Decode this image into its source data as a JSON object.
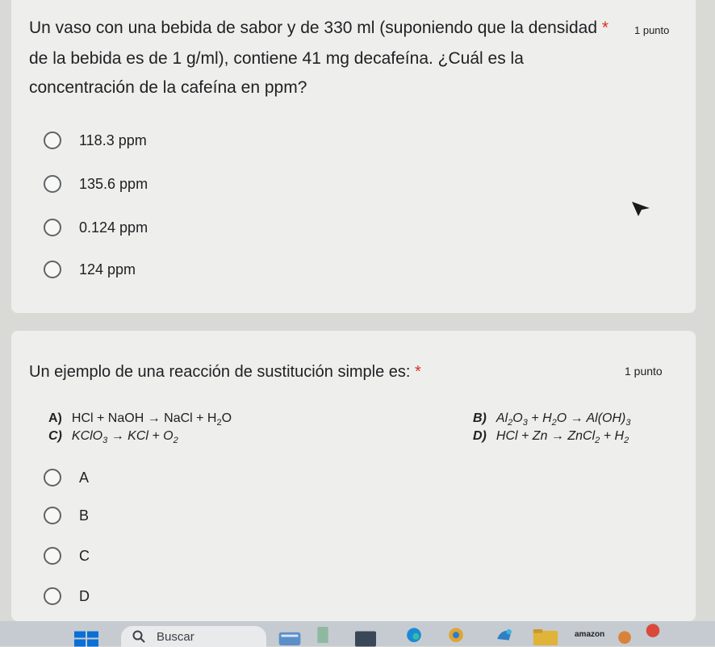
{
  "q1": {
    "line1": "Un vaso con una bebida de sabor y de 330 ml (suponiendo que la densidad",
    "required": "*",
    "points": "1 punto",
    "line2": "de la bebida es de 1 g/ml), contiene 41 mg decafeína. ¿Cuál es la",
    "line3": "concentración de la cafeína en ppm?",
    "options": [
      "118.3 ppm",
      "135.6 ppm",
      "0.124 ppm",
      "124 ppm"
    ]
  },
  "q2": {
    "title": "Un ejemplo de una reacción de sustitución simple es:",
    "required": "*",
    "points": "1 punto",
    "reactions": {
      "a_letter": "A)",
      "b_letter": "B)",
      "c_letter": "C)",
      "d_letter": "D)"
    },
    "options": [
      "A",
      "B",
      "C",
      "D"
    ]
  },
  "taskbar": {
    "search_label": "Buscar",
    "amazon_label": "amazon"
  },
  "colors": {
    "accent_required": "#d93025",
    "card_bg": "#eeeeec",
    "page_bg": "#d9d9d6"
  }
}
